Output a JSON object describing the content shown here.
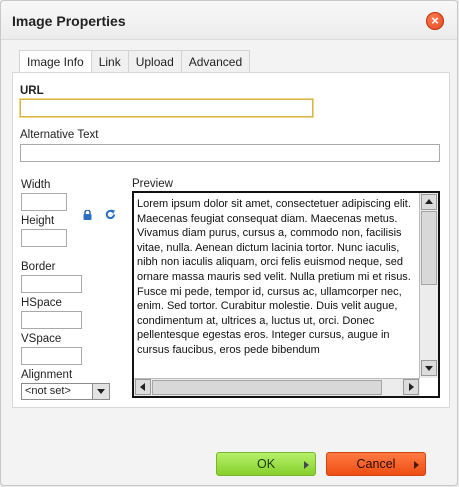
{
  "dialog": {
    "title": "Image Properties",
    "close_symbol": "×"
  },
  "tabs": [
    {
      "label": "Image Info",
      "active": true
    },
    {
      "label": "Link",
      "active": false
    },
    {
      "label": "Upload",
      "active": false
    },
    {
      "label": "Advanced",
      "active": false
    }
  ],
  "fields": {
    "url_label": "URL",
    "url_value": "",
    "alt_label": "Alternative Text",
    "alt_value": "",
    "width_label": "Width",
    "width_value": "",
    "height_label": "Height",
    "height_value": "",
    "border_label": "Border",
    "border_value": "",
    "hspace_label": "HSpace",
    "hspace_value": "",
    "vspace_label": "VSpace",
    "vspace_value": "",
    "alignment_label": "Alignment",
    "alignment_value": "<not set>"
  },
  "preview": {
    "label": "Preview",
    "text": "Lorem ipsum dolor sit amet, consectetuer adipiscing elit. Maecenas feugiat consequat diam. Maecenas metus. Vivamus diam purus, cursus a, commodo non, facilisis vitae, nulla. Aenean dictum lacinia tortor. Nunc iaculis, nibh non iaculis aliquam, orci felis euismod neque, sed ornare massa mauris sed velit. Nulla pretium mi et risus. Fusce mi pede, tempor id, cursus ac, ullamcorper nec, enim. Sed tortor. Curabitur molestie. Duis velit augue, condimentum at, ultrices a, luctus ut, orci. Donec pellentesque egestas eros. Integer cursus, augue in cursus faucibus, eros pede bibendum"
  },
  "buttons": {
    "ok": "OK",
    "cancel": "Cancel"
  },
  "colors": {
    "ok_green": "#86cf2c",
    "cancel_orange": "#ee4d12",
    "close_orange": "#e1441a",
    "focus_yellow": "#d8b24d"
  },
  "icons": {
    "lock": "lock-icon",
    "reset": "reset-size-icon",
    "close": "close-icon"
  }
}
